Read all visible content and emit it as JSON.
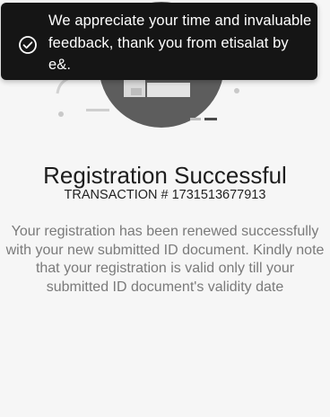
{
  "toast": {
    "icon": "check-circle-icon",
    "message": "We appreciate your time and invaluable feedback, thank you from etisalat by e&."
  },
  "illustration": {
    "icon": "success-illustration-icon"
  },
  "registration": {
    "title": "Registration Successful",
    "transaction": "TRANSACTION # 1731513677913",
    "message": "Your registration has been renewed successfully with your new submitted ID document. Kindly note that your registration is valid only till your submitted ID document's validity date"
  },
  "colors": {
    "toast_background": "#151515",
    "page_background": "#f6f6f6",
    "illustration_circle": "#595959",
    "message_text": "#7a7a7a"
  }
}
